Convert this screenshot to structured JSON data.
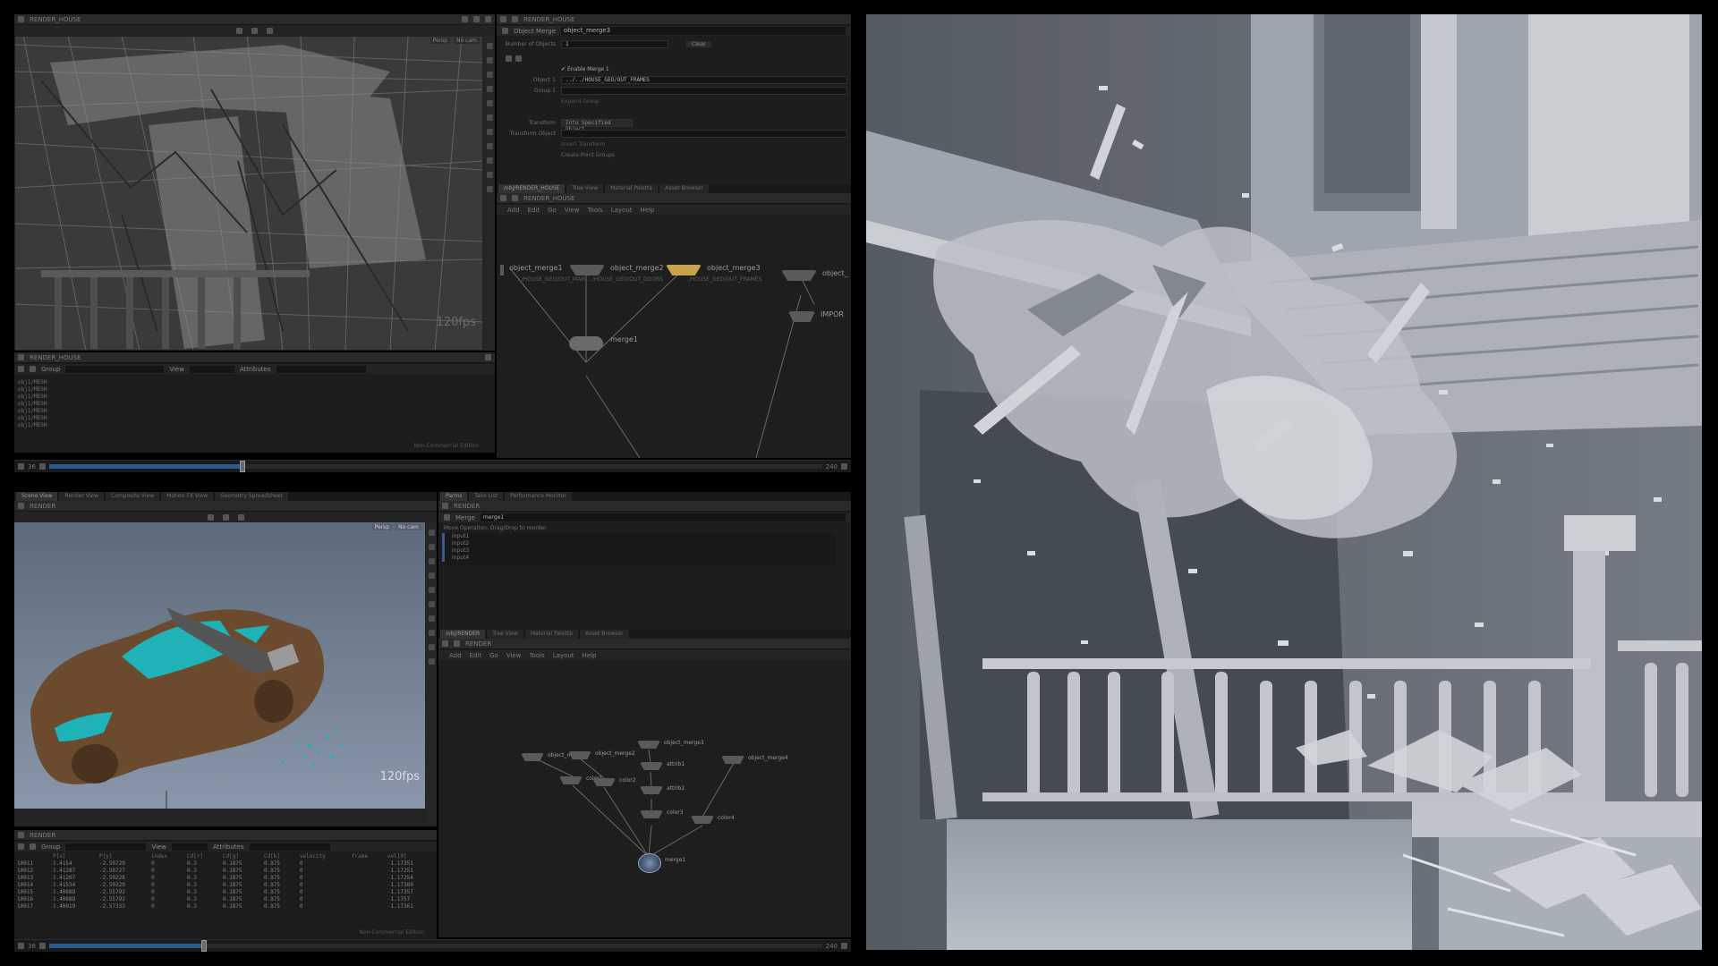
{
  "colors": {
    "background": "#000000",
    "panel": "#1f1f1f",
    "timeline_blue": "#2b5a8a",
    "car_body": "#6b4a2e",
    "car_glass": "#1fb2b6",
    "render_sky": "#8a97aa"
  },
  "top_viewport": {
    "title": "RENDER_HOUSE",
    "fps": "120fps",
    "corner_buttons": [
      "Persp",
      "No cam"
    ]
  },
  "top_spreadsheet": {
    "title": "RENDER_HOUSE",
    "group_label": "Group",
    "view_label": "View",
    "attributes_label": "Attributes",
    "rows": [
      "obj1/MESH",
      "obj1/MESH",
      "obj1/MESH",
      "obj1/MESH",
      "obj1/MESH",
      "obj1/MESH",
      "obj1/MESH"
    ],
    "watermark": "Non-Commercial Edition"
  },
  "top_timeline": {
    "frame": "36",
    "end_a": "240",
    "end_b": "240",
    "progress": 0.25
  },
  "top_params": {
    "title": "RENDER_HOUSE",
    "node_type": "Object Merge",
    "node_name": "object_merge3",
    "number_label": "Number of Objects",
    "number_value": "1",
    "clear_label": "Clear",
    "enable_label": "Enable Merge 1",
    "object_label": "Object 1",
    "object_value": "../../HOUSE_GEO/OUT_FRAMES",
    "group_label": "Group 1",
    "expand_label": "Expand Group",
    "transform_label": "Transform",
    "transform_value": "Into Specified Object",
    "transform_object_label": "Transform Object",
    "invert_label": "Invert Transform",
    "create_label": "Create Point Groups"
  },
  "top_network": {
    "tabs": [
      "/obj/RENDER_HOUSE",
      "Tree View",
      "Material Palette",
      "Asset Browser"
    ],
    "path": "RENDER_HOUSE",
    "menu": [
      "Add",
      "Edit",
      "Go",
      "View",
      "Tools",
      "Layout",
      "Help"
    ],
    "nodes": [
      {
        "label": "object_merge1",
        "sub": "../HOUSE_GEO/OUT_MAIN"
      },
      {
        "label": "object_merge2",
        "sub": "../HOUSE_GEO/OUT_DOORS"
      },
      {
        "label": "object_merge3",
        "sub": "../HOUSE_GEO/OUT_FRAMES"
      },
      {
        "label": "object_",
        "sub": ""
      },
      {
        "label": "IMPOR",
        "sub": ""
      },
      {
        "label": "merge1",
        "sub": ""
      }
    ]
  },
  "bottom_viewport": {
    "title": "RENDER",
    "tabs": [
      "Scene View",
      "Render View",
      "Composite View",
      "Motion FX View",
      "Geometry Spreadsheet"
    ],
    "fps": "120fps",
    "corner_buttons": [
      "Persp",
      "No cam"
    ]
  },
  "bottom_spreadsheet": {
    "title": "RENDER",
    "group_label": "Group",
    "view_label": "View",
    "attributes_label": "Attributes",
    "headers": [
      "",
      "P[x]",
      "P[y]",
      "index",
      "Cd[r]",
      "Cd[g]",
      "Cd[b]",
      "velocity",
      "frame",
      "vel[0]"
    ],
    "rows": [
      [
        "10011",
        "1.4154",
        "-2.59729",
        "0",
        "0.3",
        "0.1875",
        "0.875",
        "0",
        "",
        "-1.17351"
      ],
      [
        "10012",
        "1.41287",
        "-2.58727",
        "0",
        "0.3",
        "0.1875",
        "0.875",
        "0",
        "",
        "-1.17251"
      ],
      [
        "10013",
        "1.41207",
        "-2.59228",
        "0",
        "0.3",
        "0.1875",
        "0.875",
        "0",
        "",
        "-1.17254"
      ],
      [
        "10014",
        "1.41534",
        "-2.59329",
        "0",
        "0.3",
        "0.1875",
        "0.875",
        "0",
        "",
        "-1.17389"
      ],
      [
        "10015",
        "1.40088",
        "-2.55792",
        "0",
        "0.3",
        "0.1875",
        "0.875",
        "0",
        "",
        "-1.17357"
      ],
      [
        "10016",
        "1.40088",
        "-2.55792",
        "0",
        "0.3",
        "0.1875",
        "0.875",
        "0",
        "",
        "-1.1757"
      ],
      [
        "10017",
        "1.40019",
        "-2.57333",
        "0",
        "0.3",
        "0.1875",
        "0.875",
        "0",
        "",
        "-1.17361"
      ]
    ],
    "watermark": "Non-Commercial Edition"
  },
  "bottom_timeline": {
    "frame": "38",
    "end_a": "240",
    "progress": 0.2
  },
  "bottom_params": {
    "title": "RENDER",
    "node_type": "Merge",
    "node_name": "merge1",
    "op_label": "Move Operation: Drag/Drop to reorder",
    "tabs": [
      "Parms",
      "Take List",
      "Performance Monitor"
    ],
    "inputs": [
      "input1",
      "input2",
      "input3",
      "input4"
    ]
  },
  "bottom_network": {
    "tabs": [
      "/obj/RENDER",
      "Tree View",
      "Material Palette",
      "Asset Browser"
    ],
    "path": "RENDER",
    "menu": [
      "Add",
      "Edit",
      "Go",
      "View",
      "Tools",
      "Layout",
      "Help"
    ],
    "nodes": [
      {
        "label": "object_merge1",
        "sub": ""
      },
      {
        "label": "object_merge2",
        "sub": ""
      },
      {
        "label": "object_merge3",
        "sub": ""
      },
      {
        "label": "object_merge4",
        "sub": ""
      },
      {
        "label": "color1",
        "sub": ""
      },
      {
        "label": "color2",
        "sub": ""
      },
      {
        "label": "attrib1",
        "sub": ""
      },
      {
        "label": "attrib2",
        "sub": ""
      },
      {
        "label": "color3",
        "sub": ""
      },
      {
        "label": "color4",
        "sub": ""
      },
      {
        "label": "merge1",
        "sub": ""
      }
    ]
  },
  "render_preview": {
    "description_icon": "house-destruction-render"
  }
}
